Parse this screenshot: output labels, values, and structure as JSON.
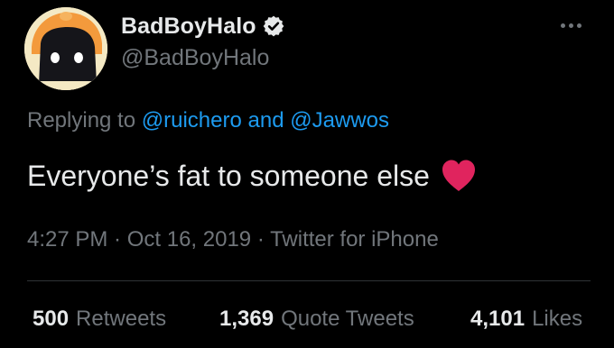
{
  "author": {
    "display_name": "BadBoyHalo",
    "handle": "@BadBoyHalo",
    "verified": true
  },
  "reply": {
    "prefix": "Replying to ",
    "mention_1": "@ruichero",
    "joiner": " and ",
    "mention_2": "@Jawwos"
  },
  "tweet": {
    "text": "Everyone’s fat to someone else",
    "emoji": "heart"
  },
  "meta": {
    "time": "4:27 PM",
    "sep1": " · ",
    "date": "Oct 16, 2019",
    "sep2": " · ",
    "source": "Twitter for iPhone"
  },
  "stats": {
    "retweets_count": "500",
    "retweets_label": "Retweets",
    "quotes_count": "1,369",
    "quotes_label": "Quote Tweets",
    "likes_count": "4,101",
    "likes_label": "Likes"
  },
  "colors": {
    "background": "#000000",
    "primary_text": "#e7e9ea",
    "secondary_text": "#71767b",
    "link": "#1d9bf0",
    "divider": "#2f3336",
    "heart": "#e0245e"
  },
  "icons": {
    "avatar": "avatar-image",
    "verified": "verified-badge-icon",
    "more": "more-options-icon",
    "heart": "red-heart-icon"
  }
}
